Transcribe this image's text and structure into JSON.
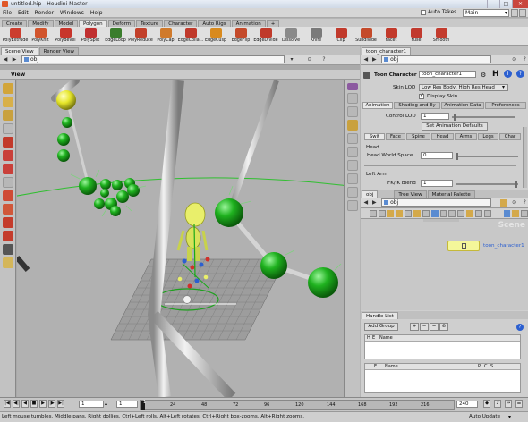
{
  "window": {
    "title": "untitled.hip - Houdini Master",
    "min": "–",
    "max": "□",
    "close": "✕"
  },
  "menu": {
    "items": [
      "File",
      "Edit",
      "Render",
      "Windows",
      "Help"
    ],
    "auto_takes_label": "Auto Takes",
    "desktop_value": "Main"
  },
  "shelf_tabs": {
    "items": [
      "Create",
      "Modify",
      "Model",
      "Polygon",
      "Deform",
      "Texture",
      "Character",
      "Auto Rigs",
      "Animation"
    ],
    "active": "Polygon",
    "more": "+"
  },
  "shelf_tools": [
    {
      "label": "PolyExtrude",
      "icon": "polyextrude-icon",
      "color": "#cc3d2e"
    },
    {
      "label": "PolyKnit",
      "icon": "polyknit-icon",
      "color": "#d1542c"
    },
    {
      "label": "PolyBevel",
      "icon": "polybevel-icon",
      "color": "#c8352b"
    },
    {
      "label": "PolySplit",
      "icon": "polysplit-icon",
      "color": "#c02f2f"
    },
    {
      "label": "EdgeLoop",
      "icon": "edgeloop-icon",
      "color": "#3a7d2c"
    },
    {
      "label": "PolyReduce",
      "icon": "polyreduce-icon",
      "color": "#c2402a"
    },
    {
      "label": "PolyCap",
      "icon": "polycap-icon",
      "color": "#d07a2b"
    },
    {
      "label": "EdgeColla...",
      "icon": "edgecollapse-icon",
      "color": "#c0392b"
    },
    {
      "label": "EdgeCusp",
      "icon": "edgecusp-icon",
      "color": "#d98a1e"
    },
    {
      "label": "EdgeFlip",
      "icon": "edgeflip-icon",
      "color": "#c44a2a"
    },
    {
      "label": "EdgeDivide",
      "icon": "edgedivide-icon",
      "color": "#c03a2a"
    },
    {
      "label": "Dissolve",
      "icon": "dissolve-icon",
      "color": "#8a8a8a"
    },
    {
      "label": "Knife",
      "icon": "knife-icon",
      "color": "#7a7a7a"
    },
    {
      "label": "Clip",
      "icon": "clip-icon",
      "color": "#c13a2c"
    },
    {
      "label": "Subdivide",
      "icon": "subdivide-icon",
      "color": "#c44a2a"
    },
    {
      "label": "Facet",
      "icon": "facet-icon",
      "color": "#c23a2b"
    },
    {
      "label": "Fuse",
      "icon": "fuse-icon",
      "color": "#c13a2e"
    },
    {
      "label": "Smooth",
      "icon": "smooth-icon",
      "color": "#c33c2e"
    }
  ],
  "left_panel": {
    "tabs": [
      "Scene View",
      "Render View"
    ],
    "active_tab": "Scene View",
    "path": "obj",
    "view_label": "View"
  },
  "viewport": {
    "scene_label": "Scene"
  },
  "parm_panel": {
    "tab": "toon_character1",
    "node_type": "Toon Character",
    "node_name": "toon_character1",
    "skin_lod_label": "Skin LOD",
    "skin_lod_value": "Low Res Body, High Res Head",
    "display_skin_label": "Display Skin",
    "tabs": [
      "Animation",
      "Shading and Ey",
      "Animation Data",
      "Preferences"
    ],
    "active_tab": "Animation",
    "control_lod_label": "Control LOD",
    "control_lod_value": "1",
    "set_defaults_label": "Set Animation Defaults",
    "subtabs": [
      "Swit",
      "Face",
      "Spine",
      "Head",
      "Arms",
      "Legs",
      "Char"
    ],
    "active_subtab": "Swit",
    "head_label": "Head",
    "head_world_space_label": "Head World Space ...",
    "head_world_space_value": "0",
    "left_arm_label": "Left Arm",
    "fkik_blend_label": "FK/IK Blend",
    "fkik_blend_value": "1"
  },
  "network": {
    "tabs": [
      "obj",
      "Tree View",
      "Material Palette"
    ],
    "active_tab": "obj",
    "path": "obj",
    "scene_label": "Scene",
    "node_label": "toon_character1"
  },
  "handle_list": {
    "tab": "Handle List",
    "add_group_label": "Add Group",
    "cols1": [
      "H",
      "E",
      "Name"
    ],
    "cols2": [
      "E",
      "Name",
      "P",
      "C",
      "S"
    ],
    "add_symbol": "+",
    "remove_symbol": "−",
    "equals_symbol": "=",
    "no_symbol": "⊘"
  },
  "timeline": {
    "start": "1",
    "current": "1",
    "end": "240",
    "ticks": [
      "24",
      "48",
      "72",
      "96",
      "120",
      "144",
      "168",
      "192",
      "216"
    ],
    "frame_field": "1"
  },
  "status": {
    "text": "Left mouse tumbles. Middle pans. Right dollies. Ctrl+Left rolls. Alt+Left rotates. Ctrl+Right box-zooms. Alt+Right zooms.",
    "auto_update_label": "Auto Update"
  },
  "colors": {
    "joint_green": "#19a919",
    "skeleton_grey": "#d9d9d9",
    "node_yellow": "#f4f79a",
    "node_blue": "#2b5fd0"
  }
}
